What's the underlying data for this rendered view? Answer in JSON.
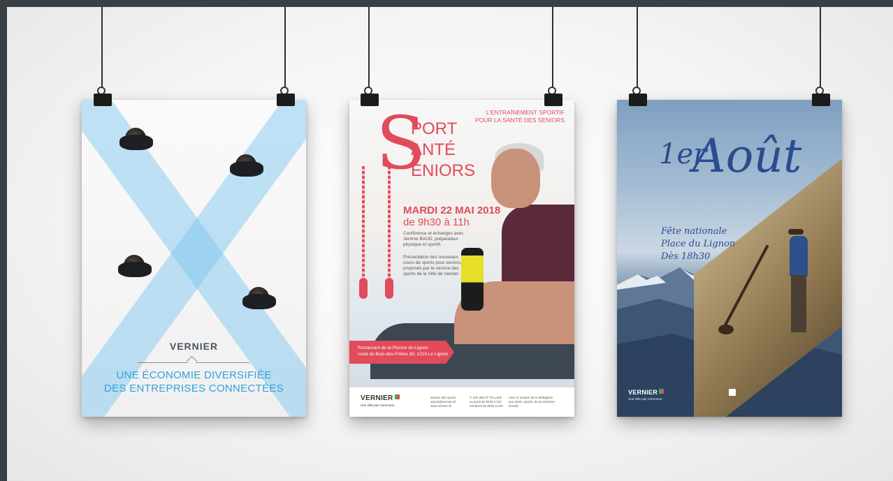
{
  "poster1": {
    "brand": "VERNIER",
    "tagline1": "UNE ÉCONOMIE DIVERSIFIÉE",
    "tagline2": "DES ENTREPRISES CONNECTÉES"
  },
  "poster2": {
    "top1": "L'ENTRAÎNEMENT SPORTIF",
    "top2": "POUR LA SANTÉ DES SENIORS",
    "big_s": "S",
    "w1": "PORT",
    "w2": "ANTÉ",
    "w3": "ENIORS",
    "date1": "MARDI 22 MAI 2018",
    "date2": "de 9h30 à 11h",
    "body1": "Conférence et échanges avec Jérôme BAUD, préparateur physique et sportif.",
    "body2": "Présentation des nouveaux cours de sports pour seniors, proposés par le service des sports de la Ville de Vernier.",
    "banner1": "Restaurant de la Piscine du Lignon",
    "banner2": "route du Bois-des-Frères 30, 1219 Le Lignon",
    "logo": "VERNIER",
    "logo_sub": "Une Ville pas Commune",
    "col1": "service des sports sports@vernier.ch www.vernier.ch",
    "col2": "T. 022 306 07 79 Lundi au jeudi de 8h30 à 11h Vendredi de 8h30 à 12h",
    "col3": "Avec le soutien de la délégation aux aînés, sports, de la cohésion sociale"
  },
  "poster3": {
    "title_small": "1er",
    "title_big": "Août",
    "info1": "Fête nationale",
    "info2": "Place du Lignon",
    "info3": "Dès 18h30",
    "logo": "VERNIER",
    "logo_sub": "Une Ville pas Commune"
  },
  "colors": {
    "sport_red": "#e14b5a",
    "vernier_blue": "#2ea3dc",
    "aout_blue": "#2a4d8f"
  }
}
